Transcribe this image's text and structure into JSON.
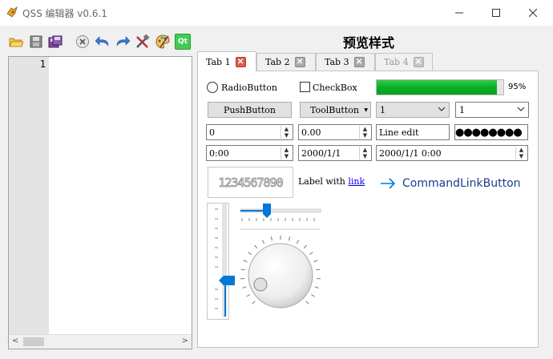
{
  "window": {
    "title": "QSS 编辑器 v0.6.1",
    "minimize": "—",
    "maximize": "☐",
    "close": "✕"
  },
  "toolbar": {
    "icons": [
      "open-folder-icon",
      "save-icon",
      "save-as-icon",
      "clear-icon",
      "undo-icon",
      "redo-icon",
      "tools-icon",
      "palette-icon",
      "qt-icon"
    ],
    "qt_label": "Qt"
  },
  "editor": {
    "line_number": "1"
  },
  "preview": {
    "title": "预览样式",
    "tabs": [
      {
        "label": "Tab 1"
      },
      {
        "label": "Tab 2"
      },
      {
        "label": "Tab 3"
      },
      {
        "label": "Tab 4"
      }
    ],
    "radio_label": "RadioButton",
    "checkbox_label": "CheckBox",
    "progress": {
      "value": 0.95,
      "text": "95%"
    },
    "push_button": "PushButton",
    "tool_button": "ToolButton",
    "combo1": "1",
    "combo2": "1",
    "spin_int": "0",
    "spin_double": "0.00",
    "line_edit": "Line edit",
    "password_dots": "●●●●●●●●",
    "time_edit": "0:00",
    "date_edit": "2000/1/1",
    "datetime_edit": "2000/1/1 0:00",
    "lcd_value": "1234567890",
    "label_text": "Label with ",
    "label_link": "link",
    "command_link": "CommandLinkButton",
    "colors": {
      "accent": "#0078d7",
      "progress": "#06b025",
      "close_red": "#e05c4b",
      "link": "#0000ee"
    }
  }
}
